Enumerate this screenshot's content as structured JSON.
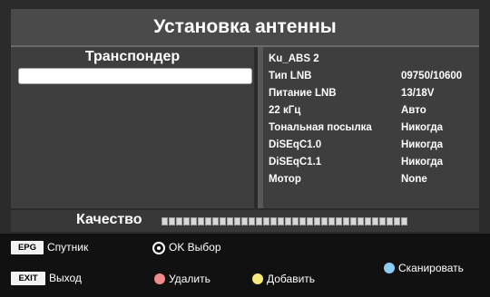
{
  "title": "Установка антенны",
  "transponder_panel": {
    "header": "Транспондер",
    "selected_item": ""
  },
  "info": {
    "satellite": "Ku_ABS 2",
    "rows": [
      {
        "label": "Тип LNB",
        "value": "09750/10600"
      },
      {
        "label": "Питание LNB",
        "value": "13/18V"
      },
      {
        "label": "22 кГц",
        "value": "Авто"
      },
      {
        "label": "Тональная посылка",
        "value": "Никогда"
      },
      {
        "label": "DiSEqC1.0",
        "value": "Никогда"
      },
      {
        "label": "DiSEqC1.1",
        "value": "Никогда"
      },
      {
        "label": "Мотор",
        "value": "None"
      }
    ]
  },
  "quality": {
    "label": "Качество",
    "level": 0,
    "segments": 34
  },
  "footer": {
    "epg_key": "EPG",
    "epg_label": "Спутник",
    "ok_label": "OK Выбор",
    "exit_key": "EXIT",
    "exit_label": "Выход",
    "red_label": "Удалить",
    "yellow_label": "Добавить",
    "blue_label": "Сканировать"
  },
  "colors": {
    "red": "#f28b8b",
    "yellow": "#f3ea7a",
    "blue": "#8ecbf0"
  }
}
